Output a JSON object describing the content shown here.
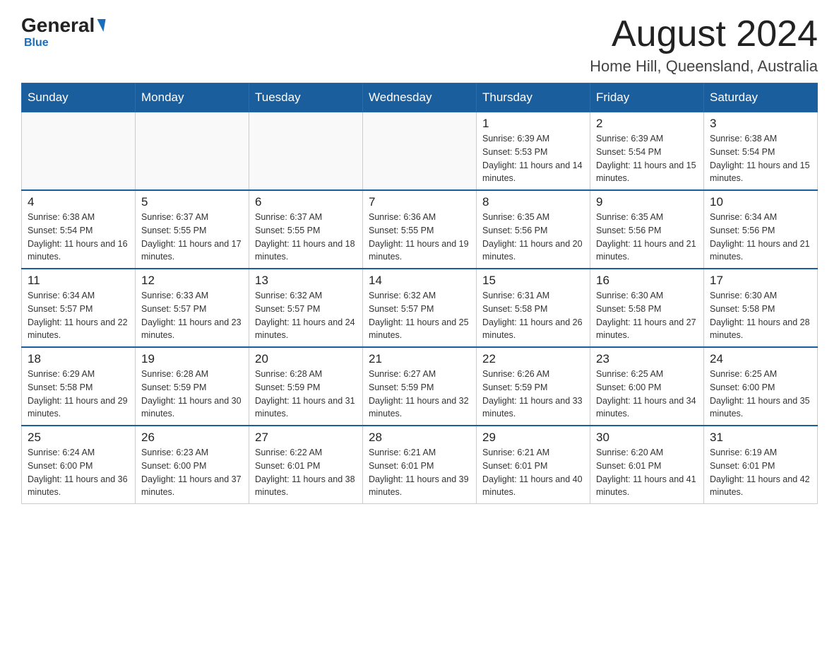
{
  "header": {
    "logo_general": "General",
    "logo_blue": "Blue",
    "month": "August 2024",
    "location": "Home Hill, Queensland, Australia"
  },
  "days_of_week": [
    "Sunday",
    "Monday",
    "Tuesday",
    "Wednesday",
    "Thursday",
    "Friday",
    "Saturday"
  ],
  "weeks": [
    [
      {
        "day": "",
        "info": ""
      },
      {
        "day": "",
        "info": ""
      },
      {
        "day": "",
        "info": ""
      },
      {
        "day": "",
        "info": ""
      },
      {
        "day": "1",
        "info": "Sunrise: 6:39 AM\nSunset: 5:53 PM\nDaylight: 11 hours and 14 minutes."
      },
      {
        "day": "2",
        "info": "Sunrise: 6:39 AM\nSunset: 5:54 PM\nDaylight: 11 hours and 15 minutes."
      },
      {
        "day": "3",
        "info": "Sunrise: 6:38 AM\nSunset: 5:54 PM\nDaylight: 11 hours and 15 minutes."
      }
    ],
    [
      {
        "day": "4",
        "info": "Sunrise: 6:38 AM\nSunset: 5:54 PM\nDaylight: 11 hours and 16 minutes."
      },
      {
        "day": "5",
        "info": "Sunrise: 6:37 AM\nSunset: 5:55 PM\nDaylight: 11 hours and 17 minutes."
      },
      {
        "day": "6",
        "info": "Sunrise: 6:37 AM\nSunset: 5:55 PM\nDaylight: 11 hours and 18 minutes."
      },
      {
        "day": "7",
        "info": "Sunrise: 6:36 AM\nSunset: 5:55 PM\nDaylight: 11 hours and 19 minutes."
      },
      {
        "day": "8",
        "info": "Sunrise: 6:35 AM\nSunset: 5:56 PM\nDaylight: 11 hours and 20 minutes."
      },
      {
        "day": "9",
        "info": "Sunrise: 6:35 AM\nSunset: 5:56 PM\nDaylight: 11 hours and 21 minutes."
      },
      {
        "day": "10",
        "info": "Sunrise: 6:34 AM\nSunset: 5:56 PM\nDaylight: 11 hours and 21 minutes."
      }
    ],
    [
      {
        "day": "11",
        "info": "Sunrise: 6:34 AM\nSunset: 5:57 PM\nDaylight: 11 hours and 22 minutes."
      },
      {
        "day": "12",
        "info": "Sunrise: 6:33 AM\nSunset: 5:57 PM\nDaylight: 11 hours and 23 minutes."
      },
      {
        "day": "13",
        "info": "Sunrise: 6:32 AM\nSunset: 5:57 PM\nDaylight: 11 hours and 24 minutes."
      },
      {
        "day": "14",
        "info": "Sunrise: 6:32 AM\nSunset: 5:57 PM\nDaylight: 11 hours and 25 minutes."
      },
      {
        "day": "15",
        "info": "Sunrise: 6:31 AM\nSunset: 5:58 PM\nDaylight: 11 hours and 26 minutes."
      },
      {
        "day": "16",
        "info": "Sunrise: 6:30 AM\nSunset: 5:58 PM\nDaylight: 11 hours and 27 minutes."
      },
      {
        "day": "17",
        "info": "Sunrise: 6:30 AM\nSunset: 5:58 PM\nDaylight: 11 hours and 28 minutes."
      }
    ],
    [
      {
        "day": "18",
        "info": "Sunrise: 6:29 AM\nSunset: 5:58 PM\nDaylight: 11 hours and 29 minutes."
      },
      {
        "day": "19",
        "info": "Sunrise: 6:28 AM\nSunset: 5:59 PM\nDaylight: 11 hours and 30 minutes."
      },
      {
        "day": "20",
        "info": "Sunrise: 6:28 AM\nSunset: 5:59 PM\nDaylight: 11 hours and 31 minutes."
      },
      {
        "day": "21",
        "info": "Sunrise: 6:27 AM\nSunset: 5:59 PM\nDaylight: 11 hours and 32 minutes."
      },
      {
        "day": "22",
        "info": "Sunrise: 6:26 AM\nSunset: 5:59 PM\nDaylight: 11 hours and 33 minutes."
      },
      {
        "day": "23",
        "info": "Sunrise: 6:25 AM\nSunset: 6:00 PM\nDaylight: 11 hours and 34 minutes."
      },
      {
        "day": "24",
        "info": "Sunrise: 6:25 AM\nSunset: 6:00 PM\nDaylight: 11 hours and 35 minutes."
      }
    ],
    [
      {
        "day": "25",
        "info": "Sunrise: 6:24 AM\nSunset: 6:00 PM\nDaylight: 11 hours and 36 minutes."
      },
      {
        "day": "26",
        "info": "Sunrise: 6:23 AM\nSunset: 6:00 PM\nDaylight: 11 hours and 37 minutes."
      },
      {
        "day": "27",
        "info": "Sunrise: 6:22 AM\nSunset: 6:01 PM\nDaylight: 11 hours and 38 minutes."
      },
      {
        "day": "28",
        "info": "Sunrise: 6:21 AM\nSunset: 6:01 PM\nDaylight: 11 hours and 39 minutes."
      },
      {
        "day": "29",
        "info": "Sunrise: 6:21 AM\nSunset: 6:01 PM\nDaylight: 11 hours and 40 minutes."
      },
      {
        "day": "30",
        "info": "Sunrise: 6:20 AM\nSunset: 6:01 PM\nDaylight: 11 hours and 41 minutes."
      },
      {
        "day": "31",
        "info": "Sunrise: 6:19 AM\nSunset: 6:01 PM\nDaylight: 11 hours and 42 minutes."
      }
    ]
  ]
}
